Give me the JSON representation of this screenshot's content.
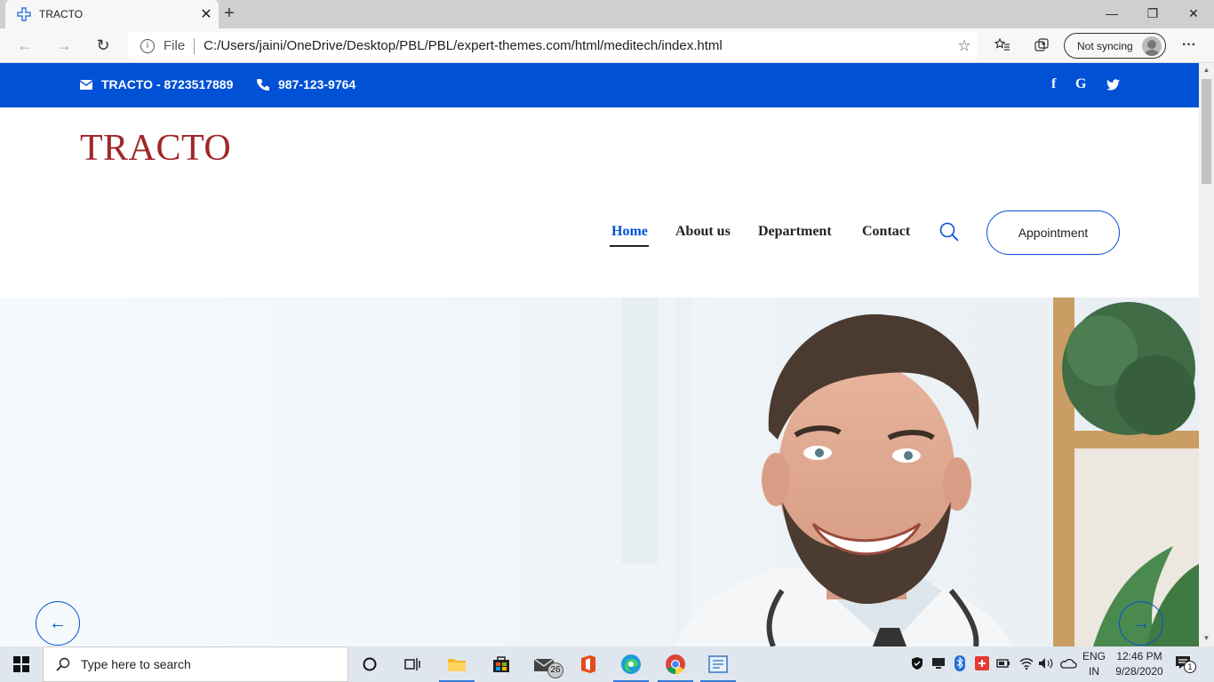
{
  "browser": {
    "tab_title": "TRACTO",
    "tab_close": "✕",
    "new_tab": "+",
    "window_controls": {
      "minimize": "—",
      "restore": "❐",
      "close": "✕"
    },
    "address": {
      "info_glyph": "i",
      "scheme_label": "File",
      "url": "C:/Users/jaini/OneDrive/Desktop/PBL/PBL/expert-themes.com/html/meditech/index.html"
    },
    "sync_label": "Not syncing",
    "more_label": "···"
  },
  "site": {
    "topbar": {
      "email_text": "TRACTO - 8723517889",
      "phone_text": "987-123-9764",
      "social": {
        "facebook": "f",
        "google": "G",
        "twitter": "t"
      },
      "bg_color": "#0051d6"
    },
    "logo": "TRACTO",
    "logo_color": "#a0262a",
    "nav": {
      "items": [
        {
          "label": "Home",
          "active": true
        },
        {
          "label": "About us",
          "active": false
        },
        {
          "label": "Department",
          "active": false
        },
        {
          "label": "Contact",
          "active": false
        }
      ],
      "appointment_label": "Appointment"
    },
    "hero": {
      "prev_glyph": "←",
      "next_glyph": "→"
    }
  },
  "taskbar": {
    "search_placeholder": "Type here to search",
    "mail_badge": "26",
    "language": {
      "line1": "ENG",
      "line2": "IN"
    },
    "time": "12:46 PM",
    "date": "9/28/2020",
    "notification_count": "1"
  }
}
